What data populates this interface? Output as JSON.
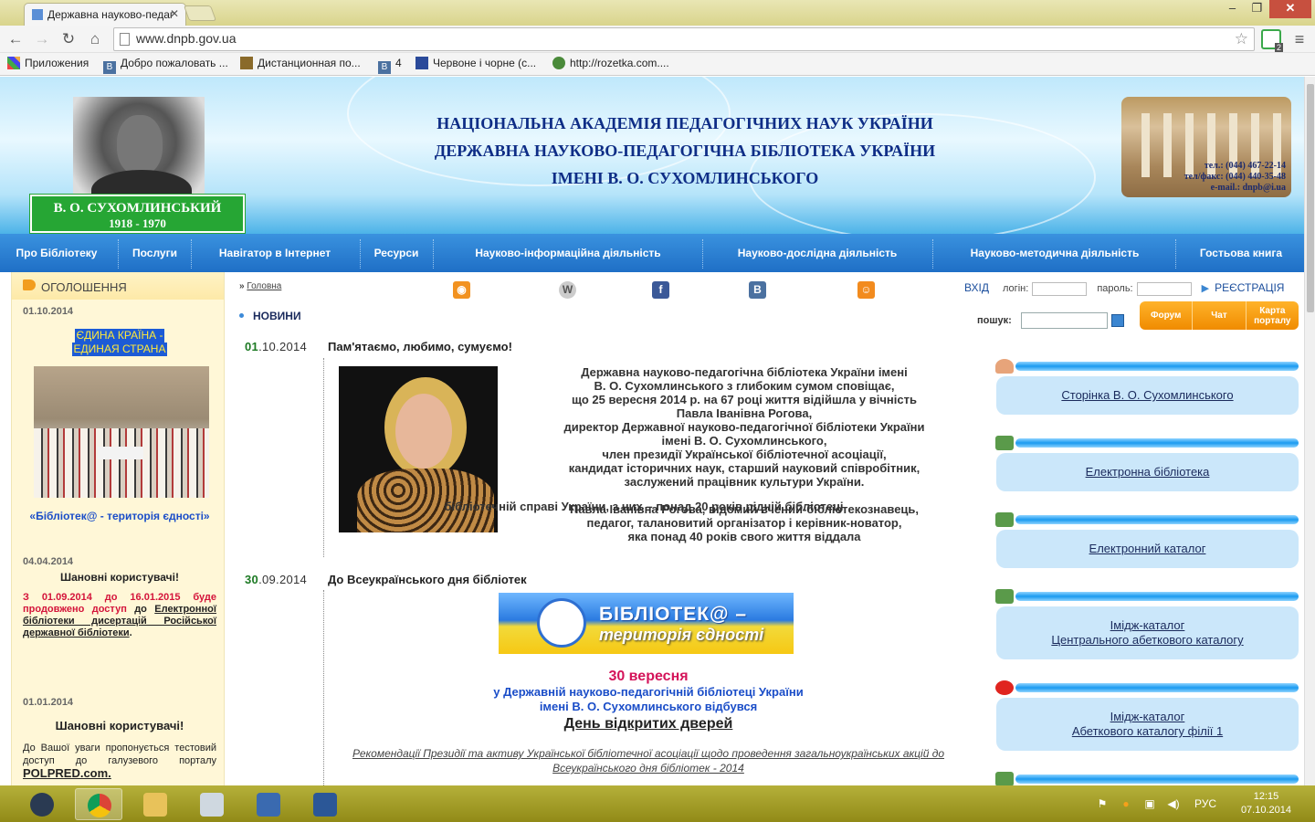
{
  "browser": {
    "tab_title": "Державна науково-педаг",
    "url": "www.dnpb.gov.ua",
    "ext_badge": "2",
    "bookmarks": [
      "Приложения",
      "Добро пожаловать ...",
      "Дистанционная по...",
      "4",
      "Червоне і чорне (с...",
      "http://rozetka.com...."
    ]
  },
  "header": {
    "name": "В. О. СУХОМЛИНСЬКИЙ",
    "years": "1918 - 1970",
    "title_line1": "НАЦІОНАЛЬНА АКАДЕМІЯ ПЕДАГОГІЧНИХ НАУК УКРАЇНИ",
    "title_line2": "ДЕРЖАВНА НАУКОВО-ПЕДАГОГІЧНА БІБЛІОТЕКА УКРАЇНИ",
    "title_line3": "ІМЕНІ В. О.  СУХОМЛИНСЬКОГО",
    "phone": "тел.: (044) 467-22-14",
    "fax": "тел/факс: (044) 440-35-48",
    "email": "e-mail.: dnpb@i.ua"
  },
  "menu": [
    "Про Бібліотеку",
    "Послуги",
    "Навігатор в Інтернет",
    "Ресурси",
    "Науково-інформаційна діяльність",
    "Науково-дослідна діяльність",
    "Науково-методична діяльність",
    "Гостьова книга"
  ],
  "left": {
    "header": "ОГОЛОШЕННЯ",
    "item1_date": "01.10.2014",
    "item1_hl1": "ЄДИНА КРАЇНА -",
    "item1_hl2": "ЕДИНАЯ СТРАНА",
    "item1_caption": "«Бібліотек@ - територія єдності»",
    "item2_date": "04.04.2014",
    "item2_title": "Шановні користувачі!",
    "item2_red": "З 01.09.2014 до 16.01.2015 буде продовжено доступ",
    "item2_to": "до",
    "item2_link": "Електронної бібліотеки дисертацій Російської державної бібліотеки",
    "item3_date": "01.01.2014",
    "item3_title": "Шановні користувачі!",
    "item3_text": "До Вашої уваги пропонується тестовий доступ до галузевого порталу",
    "item3_link": "POLPRED.com."
  },
  "toprow": {
    "breadcrumb_sep": "»",
    "breadcrumb": "Головна",
    "login_entry": "ВХІД",
    "login_label": "логін:",
    "password_label": "пароль:",
    "register": "РЕЄСТРАЦІЯ",
    "social": [
      "rss-icon",
      "wiki-icon",
      "facebook-icon",
      "vkontakte-icon",
      "odnoklassniki-icon"
    ]
  },
  "news": {
    "heading": "НОВИНИ",
    "search_label": "пошук:",
    "orange_tabs": [
      "Форум",
      "Чат",
      "Карта порталу"
    ],
    "n1_day": "01",
    "n1_rest": ".10.2014",
    "n1_title": "Пам'ятаємо, любимо, сумуємо!",
    "n1_text1": "Державна науково-педагогічна бібліотека України імені\nВ. О. Сухомлинського з глибоким сумом сповіщає,\nщо 25 вересня 2014 р. на 67 році життя відійшла у вічність\nПавла Іванівна Рогова,\nдиректор Державної науково-педагогічної бібліотеки України\nімені В. О. Сухомлинського,\nчлен президії Української бібліотечної асоціації,\nкандидат історичних наук, старший науковий  співробітник,\nзаслужений працівник культури України.\n\nПавла Іванівна Рогова, відомий вчений-бібліотекознавець,\nпедагог, талановитий організатор і керівник-новатор,\nяка понад 40 років свого життя віддала",
    "n1_text2": "бібліотечній справі України, з них – понад 20 років рідній бібліотеці",
    "n2_day": "30",
    "n2_rest": ".09.2014",
    "n2_title": "До Всеукраїнського дня бібліотек",
    "banner_t1": "БІБЛІОТЕК@ –",
    "banner_t2": "територія єдності",
    "ev_date": "30 вересня",
    "ev_line1": "у Державній науково-педагогічній бібліотеці України",
    "ev_line2": "імені В. О. Сухомлинського відбувся",
    "ev_open": "День відкритих дверей",
    "recs": "Рекомендації Президії та активу Української бібліотечної асоціації щодо проведення загальноукраїнських акцій до Всеукраїнського дня бібліотек - 2014"
  },
  "right": {
    "links": [
      "Сторінка В. О. Сухомлинського",
      "Електронна бібліотека",
      "Електронний каталог",
      "Імідж-каталог\nЦентрального абеткового каталогу",
      "Імідж-каталог\nАбеткового каталогу філії 1"
    ]
  },
  "taskbar": {
    "lang": "РУС",
    "time": "12:15",
    "date": "07.10.2014"
  },
  "colors": {
    "menu_blue": "#1f6fc6",
    "accent_orange": "#f08b00",
    "date_green": "#1d7a24",
    "event_red": "#d4145a"
  }
}
